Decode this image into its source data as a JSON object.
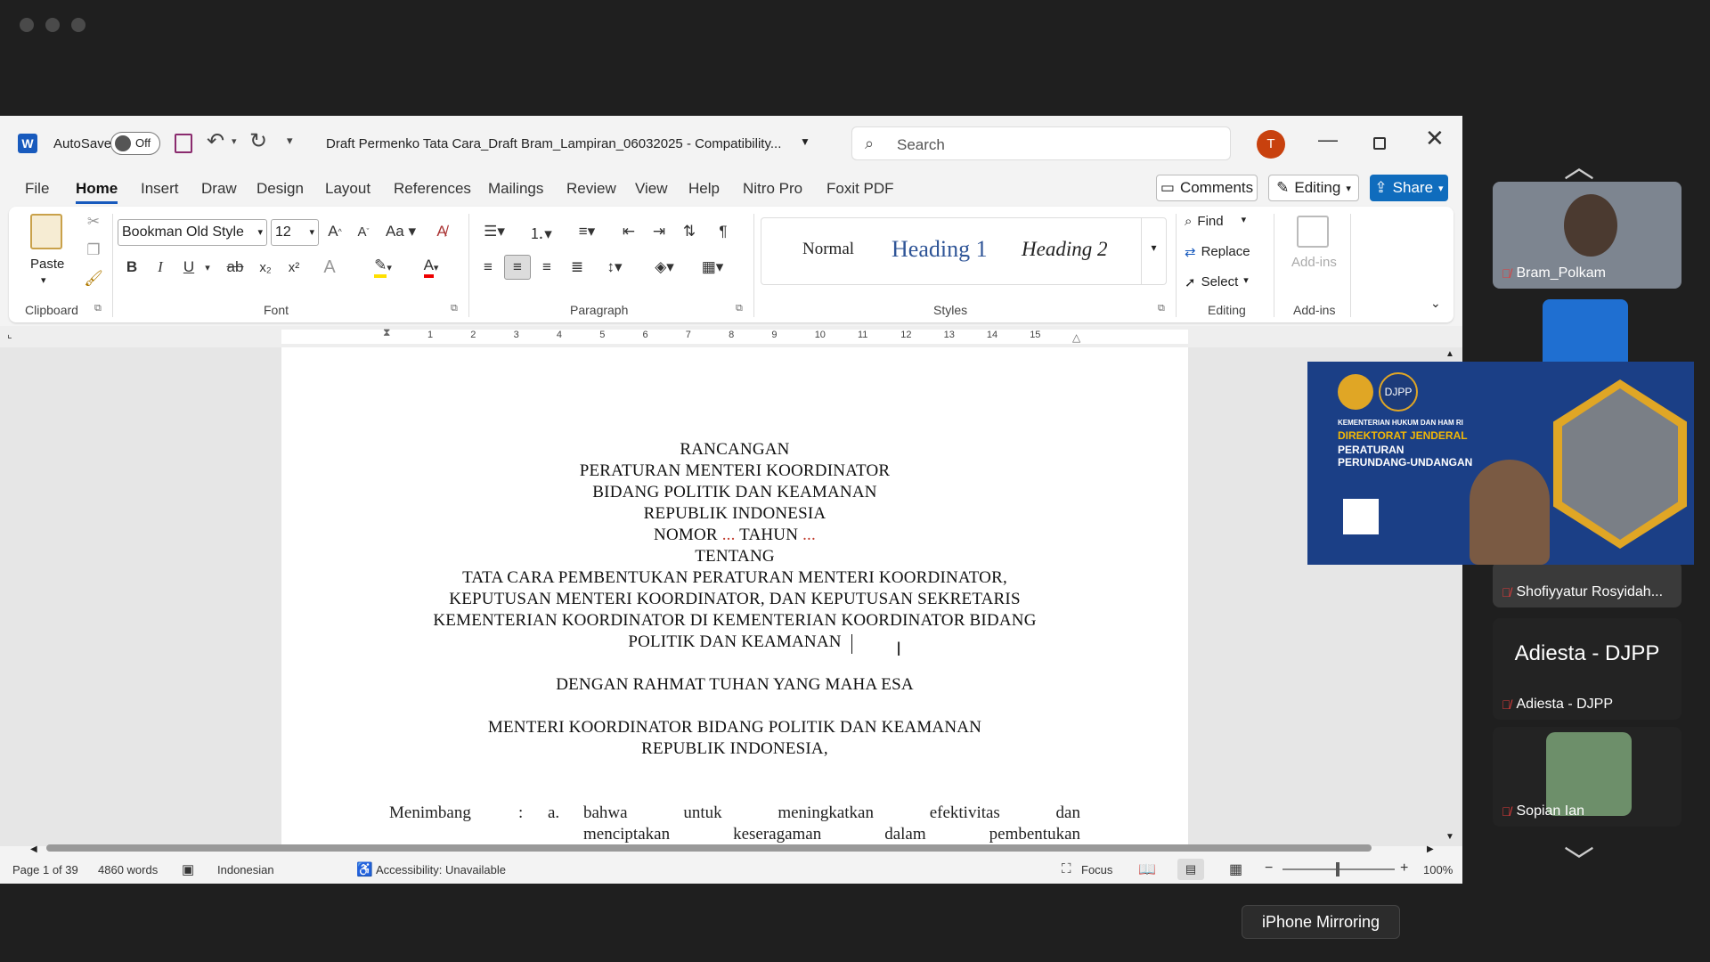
{
  "window": {
    "autosave_label": "AutoSave",
    "autosave_state": "Off",
    "doc_title": "Draft Permenko Tata Cara_Draft Bram_Lampiran_06032025  -  Compatibility...",
    "search_placeholder": "Search",
    "user_initial": "T"
  },
  "tabs": [
    "File",
    "Home",
    "Insert",
    "Draw",
    "Design",
    "Layout",
    "References",
    "Mailings",
    "Review",
    "View",
    "Help",
    "Nitro Pro",
    "Foxit PDF"
  ],
  "tab_actions": {
    "comments": "Comments",
    "editing": "Editing",
    "share": "Share"
  },
  "ribbon": {
    "paste": "Paste",
    "font_name": "Bookman Old Style",
    "font_size": "12",
    "styles": {
      "normal": "Normal",
      "h1": "Heading 1",
      "h2": "Heading 2"
    },
    "editing": {
      "find": "Find",
      "replace": "Replace",
      "select": "Select"
    },
    "addins": "Add-ins",
    "groups": {
      "clipboard": "Clipboard",
      "font": "Font",
      "paragraph": "Paragraph",
      "styles": "Styles",
      "editing": "Editing",
      "addins": "Add-ins"
    }
  },
  "ruler_numbers": [
    "1",
    "2",
    "3",
    "4",
    "5",
    "6",
    "7",
    "8",
    "9",
    "10",
    "11",
    "12",
    "13",
    "14",
    "15"
  ],
  "document": {
    "lines": [
      "RANCANGAN",
      "PERATURAN MENTERI KOORDINATOR",
      "BIDANG POLITIK DAN KEAMANAN",
      "REPUBLIK INDONESIA",
      "NOMOR ... TAHUN ...",
      "TENTANG",
      "TATA CARA PEMBENTUKAN PERATURAN MENTERI KOORDINATOR,",
      "KEPUTUSAN MENTERI KOORDINATOR, DAN KEPUTUSAN SEKRETARIS",
      "KEMENTERIAN KOORDINATOR DI KEMENTERIAN KOORDINATOR BIDANG",
      "POLITIK DAN KEAMANAN",
      "DENGAN RAHMAT TUHAN YANG MAHA ESA",
      "MENTERI KOORDINATOR BIDANG POLITIK DAN KEAMANAN",
      "REPUBLIK INDONESIA,"
    ],
    "menimbang_label": "Menimbang",
    "menimbang_colon": ":",
    "menimbang_item": "a.",
    "menimbang_text1": "bahwa untuk meningkatkan efektivitas dan",
    "menimbang_text2": "menciptakan keseragaman dalam pembentukan"
  },
  "status": {
    "page": "Page 1 of 39",
    "words": "4860 words",
    "language": "Indonesian",
    "accessibility": "Accessibility: Unavailable",
    "focus": "Focus",
    "zoom": "100%"
  },
  "participants": [
    {
      "name": "Bram_Polkam"
    },
    {
      "name": "Shofiyyatur Rosyidah..."
    },
    {
      "name": "Adiesta - DJPP",
      "big": "Adiesta - DJPP"
    },
    {
      "name": "Sopian Ian"
    }
  ],
  "share_screen": {
    "line1": "KEMENTERIAN HUKUM DAN HAM RI",
    "line2": "DIREKTORAT JENDERAL",
    "line3": "PERATURAN",
    "line4": "PERUNDANG-UNDANGAN",
    "logo_text": "DJPP"
  },
  "tooltip": "iPhone Mirroring",
  "colors": {
    "word_blue": "#185abd",
    "share_blue": "#0f6cbd",
    "accent_red": "#c0392b"
  }
}
